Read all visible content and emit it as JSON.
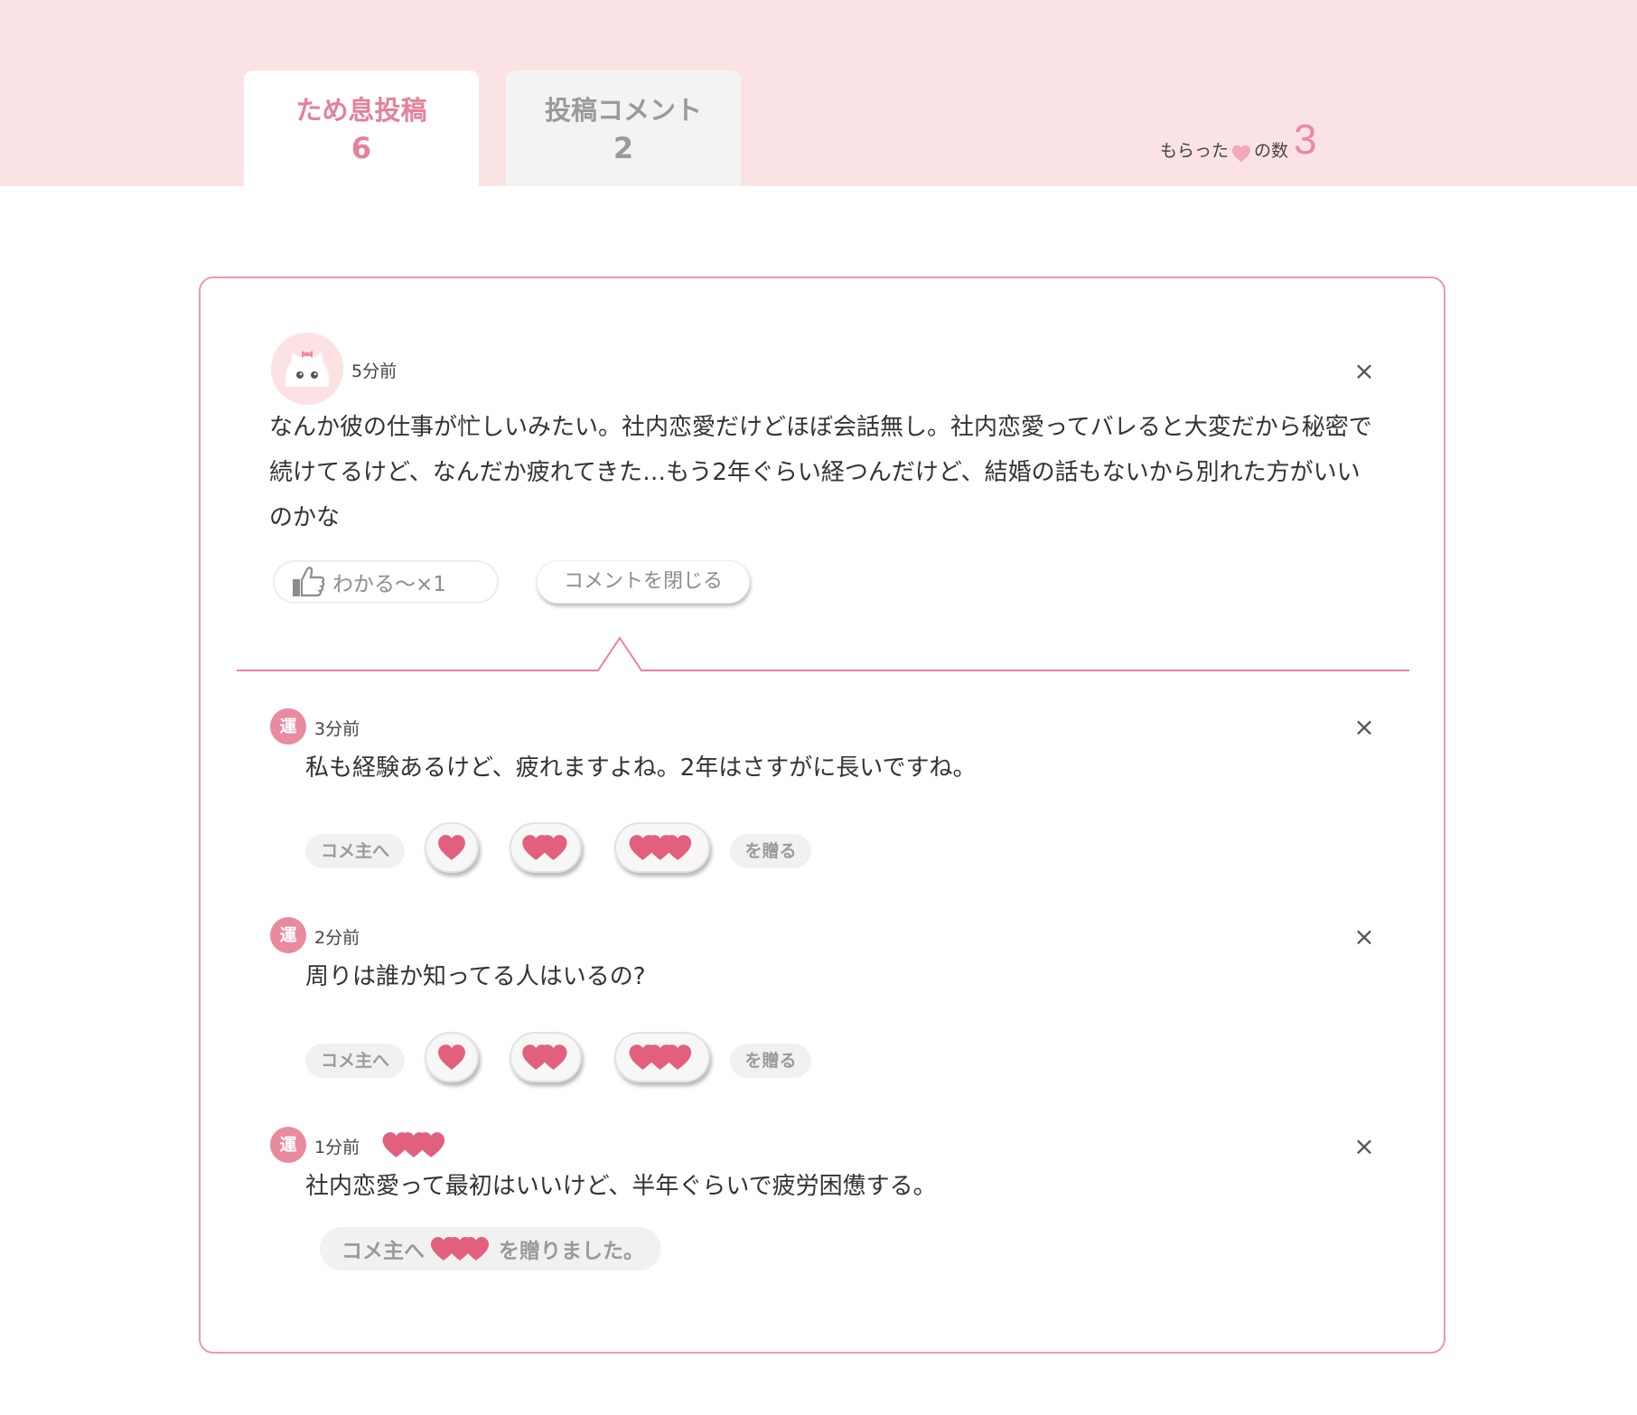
{
  "tabs": [
    {
      "label": "ため息投稿",
      "count": "6",
      "active": true
    },
    {
      "label": "投稿コメント",
      "count": "2",
      "active": false
    }
  ],
  "hearts_summary": {
    "prefix": "もらった",
    "suffix": "の数",
    "count": "3"
  },
  "post": {
    "time": "5分前",
    "body": "なんか彼の仕事が忙しいみたい。社内恋愛だけどほぼ会話無し。社内恋愛ってバレると大変だから秘密で続けてるけど、なんだか疲れてきた…もう2年ぐらい経つんだけど、結婚の話もないから別れた方がいいのかな",
    "wakaru_label": "わかる〜×1",
    "close_comments_label": "コメントを閉じる",
    "close_symbol": "×"
  },
  "comments": [
    {
      "badge": "運",
      "time": "3分前",
      "body": "私も経験あるけど、疲れますよね。2年はさすがに長いですね。",
      "close_symbol": "×"
    },
    {
      "badge": "運",
      "time": "2分前",
      "body": "周りは誰か知ってる人はいるの?",
      "close_symbol": "×"
    },
    {
      "badge": "運",
      "time": "1分前",
      "body": "社内恋愛って最初はいいけど、半年ぐらいで疲労困憊する。",
      "close_symbol": "×",
      "hearts_received": 3
    }
  ],
  "gift": {
    "prefix": "コメ主へ",
    "suffix": "を贈る",
    "options": [
      1,
      2,
      3
    ]
  },
  "gift_given": {
    "prefix": "コメ主へ",
    "suffix": "を贈りました。",
    "hearts": 3
  },
  "colors": {
    "accent": "#e88aa0",
    "heart": "#e2607e",
    "topbar": "#fbe3e5",
    "card_border": "#e99aae"
  },
  "icons": {
    "like": "thumbs-up-icon",
    "close": "close-icon",
    "heart": "heart-icon",
    "avatar": "cat-avatar-icon"
  }
}
